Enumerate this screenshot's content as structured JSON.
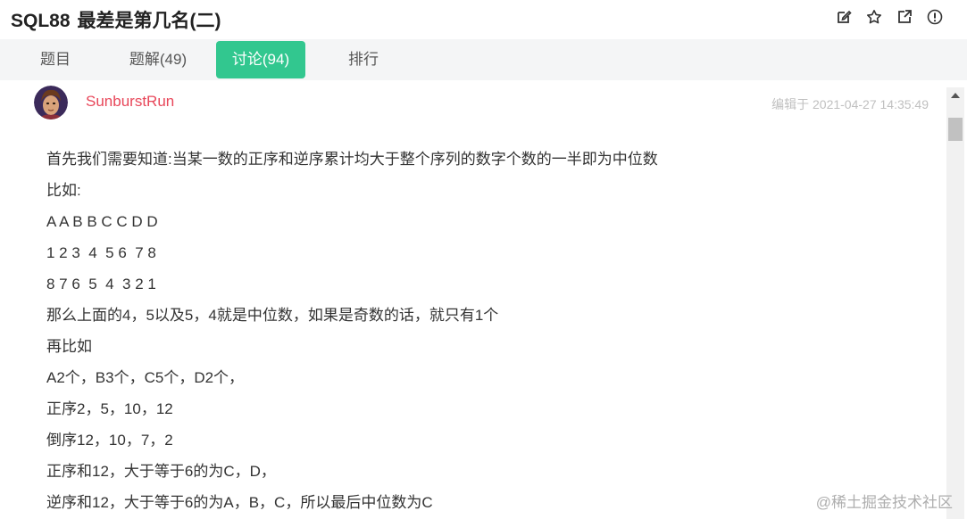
{
  "header": {
    "code": "SQL88",
    "title": "最差是第几名(二)",
    "tools": [
      "edit-icon",
      "star-icon",
      "share-icon",
      "info-icon"
    ]
  },
  "tabs": [
    {
      "label": "题目",
      "active": false
    },
    {
      "label": "题解(49)",
      "active": false
    },
    {
      "label": "讨论(94)",
      "active": true
    },
    {
      "label": "排行",
      "active": false
    }
  ],
  "post": {
    "author": "SunburstRun",
    "edited": "编辑于 2021-04-27 14:35:49",
    "lines": [
      "首先我们需要知道:当某一数的正序和逆序累计均大于整个序列的数字个数的一半即为中位数",
      "比如:",
      "A A B B C C D D",
      "1 2 3  4  5 6  7 8",
      "8 7 6  5  4  3 2 1",
      "那么上面的4，5以及5，4就是中位数，如果是奇数的话，就只有1个",
      "再比如",
      "A2个，B3个，C5个，D2个，",
      "正序2，5，10，12",
      "倒序12，10，7，2",
      "正序和12，大于等于6的为C，D，",
      "逆序和12，大于等于6的为A，B，C，所以最后中位数为C"
    ]
  },
  "watermark": "@稀土掘金技术社区",
  "colors": {
    "accent": "#32c78f",
    "author": "#e8475a",
    "muted": "#c0c0c0"
  }
}
